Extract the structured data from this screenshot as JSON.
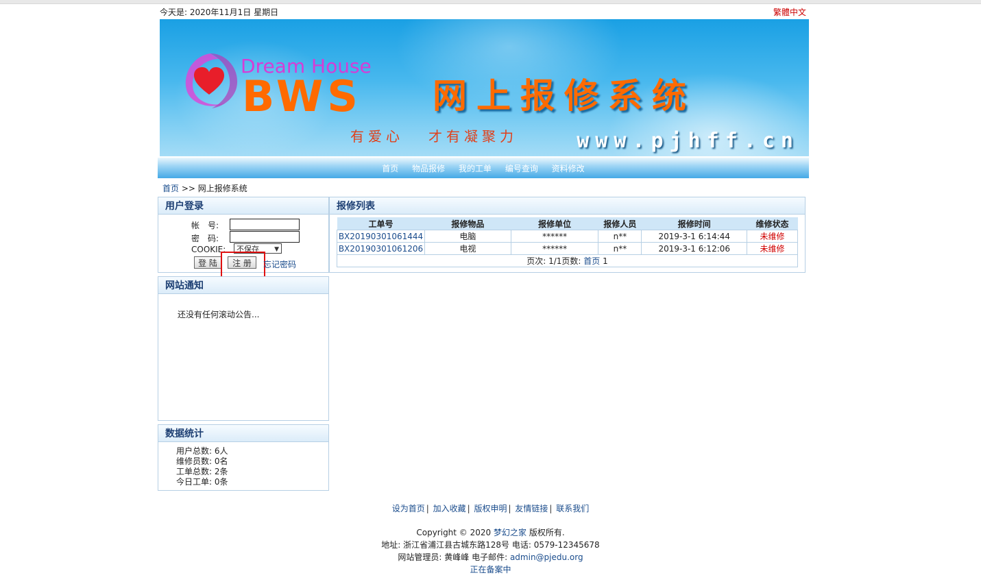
{
  "header": {
    "date_text": "今天是: 2020年11月1日 星期日",
    "lang_link": "繁體中文"
  },
  "banner": {
    "brand_en": "Dream House",
    "brand_abbr": "BWS",
    "title": "网上报修系统",
    "slogan1": "有爱心",
    "slogan2": "才有凝聚力",
    "domain": "www.pjhff.cn"
  },
  "nav": {
    "items": [
      "首页",
      "物品报修",
      "我的工单",
      "编号查询",
      "资料修改"
    ]
  },
  "breadcrumb": {
    "home": "首页",
    "sep": " >> ",
    "current": "网上报修系统"
  },
  "login": {
    "title": "用户登录",
    "account_label": "帐　号:",
    "password_label": "密　码:",
    "cookie_label": "COOKIE:",
    "cookie_value": "不保存",
    "login_button": "登 陆",
    "register_button": "注 册",
    "forgot_link": "忘记密码"
  },
  "notice": {
    "title": "网站通知",
    "text": "还没有任何滚动公告..."
  },
  "stats": {
    "title": "数据统计",
    "lines": [
      "用户总数: 6人",
      "维修员数: 0名",
      "工单总数: 2条",
      "今日工单: 0条"
    ]
  },
  "repair_list": {
    "title": "报修列表",
    "columns": [
      "工单号",
      "报修物品",
      "报修单位",
      "报修人员",
      "报修时间",
      "维修状态"
    ],
    "rows": [
      [
        "BX20190301061444",
        "电脑",
        "******",
        "n**",
        "2019-3-1 6:14:44",
        "未维修"
      ],
      [
        "BX20190301061206",
        "电视",
        "******",
        "n**",
        "2019-3-1 6:12:06",
        "未维修"
      ]
    ],
    "pager_text": "页次: 1/1页数:",
    "pager_link": "首页",
    "pager_num": "1"
  },
  "footer": {
    "links": [
      "设为首页",
      "加入收藏",
      "版权申明",
      "友情链接",
      "联系我们"
    ],
    "copyright_prefix": "Copyright © 2020 ",
    "copyright_link": "梦幻之家",
    "copyright_suffix": " 版权所有.",
    "address": "地址: 浙江省浦江县古城东路128号 电话: 0579-12345678",
    "admin_prefix": "网站管理员: ",
    "admin_name": "黄峰峰",
    "admin_mid": " 电子邮件: ",
    "admin_email": "admin@pjedu.org",
    "icp": "正在备案中"
  },
  "colors": {
    "accent_red": "#d00000",
    "link_blue": "#1a4c8c",
    "panel_title": "#1d3f73",
    "banner_blue": "#1aa0e4",
    "brand_orange": "#ff6a00"
  }
}
